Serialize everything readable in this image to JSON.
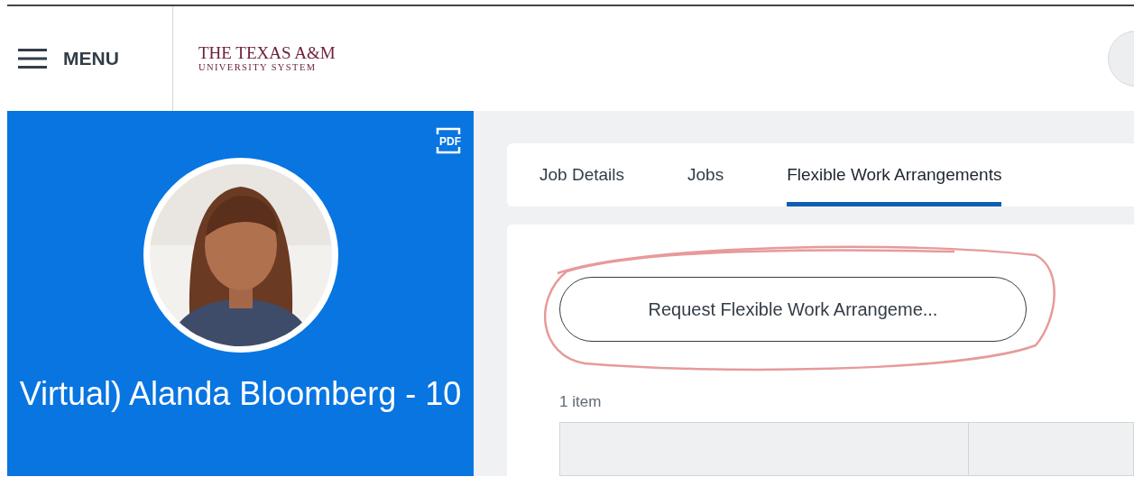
{
  "header": {
    "menu_label": "MENU",
    "logo_line_1": "THE TEXAS A&M",
    "logo_line_2": "UNIVERSITY SYSTEM"
  },
  "profile": {
    "pdf_label": "PDF",
    "name": "Virtual) Alanda Bloomberg - 10"
  },
  "tabs": [
    {
      "label": "Job Details",
      "selected": false
    },
    {
      "label": "Jobs",
      "selected": false
    },
    {
      "label": "Flexible Work Arrangements",
      "selected": true
    }
  ],
  "action_button": {
    "label": "Request Flexible Work Arrangeme...",
    "annotated": true
  },
  "table": {
    "count": "1 item"
  }
}
